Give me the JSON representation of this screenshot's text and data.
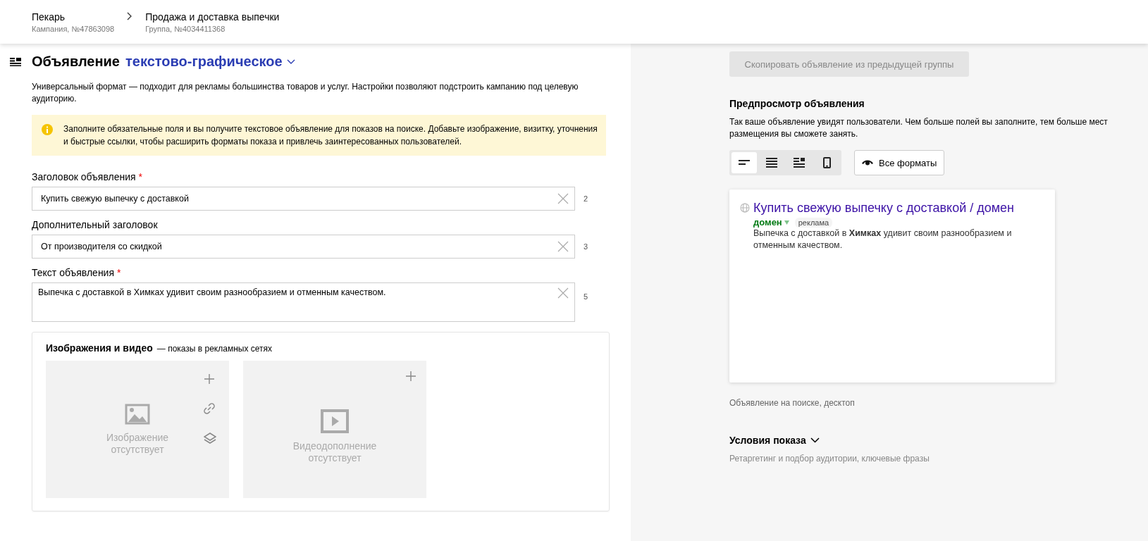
{
  "header": {
    "breadcrumbs": [
      {
        "title": "Пекарь",
        "subtitle": "Кампания, №47863098"
      },
      {
        "title": "Продажа и доставка выпечки",
        "subtitle": "Группа, №4034411368"
      }
    ]
  },
  "ad_type": {
    "prefix": "Объявление",
    "value": "текстово-графическое"
  },
  "description": "Универсальный формат — подходит для рекламы большинства товаров и услуг. Настройки позволяют подстроить кампанию под целевую аудиторию.",
  "notice": "Заполните обязательные поля и вы получите текстовое объявление для показов на поиске. Добавьте изображение, визитку, уточнения и быстрые ссылки, чтобы расширить форматы показа и привлечь заинтересованных пользователей.",
  "required_mark": "*",
  "fields": [
    {
      "kind": "input",
      "label": "Заголовок объявления",
      "required": true,
      "value": "Купить свежую выпечку с доставкой",
      "counter": "2"
    },
    {
      "kind": "input",
      "label": "Дополнительный заголовок",
      "required": false,
      "value": "От производителя со скидкой",
      "counter": "3"
    },
    {
      "kind": "textarea",
      "label": "Текст объявления",
      "required": true,
      "value": "Выпечка с доставкой в Химках удивит своим разнообразием и отменным качеством.",
      "counter": "5"
    }
  ],
  "media": {
    "title": "Изображения и видео",
    "subtitle": "— показы в рекламных сетях",
    "slots": [
      {
        "kind": "image",
        "text": "Изображение отсутствует"
      },
      {
        "kind": "video",
        "text": "Видеодополнение отсутствует"
      }
    ]
  },
  "preview": {
    "copy_button": "Скопировать объявление из предыдущей группы",
    "title": "Предпросмотр объявления",
    "description": "Так ваше объявление увидят пользователи. Чем больше полей вы заполните, тем больше мест размещения вы сможете занять.",
    "formats": [
      {
        "kind": "search",
        "selected": true
      },
      {
        "kind": "lines",
        "selected": false
      },
      {
        "kind": "image",
        "selected": false
      },
      {
        "kind": "mobile",
        "selected": false
      }
    ],
    "all_formats_button": "Все форматы",
    "ad": {
      "title": "Купить свежую выпечку с доставкой / домен",
      "domain": "домен",
      "badge": "реклама",
      "text": "Выпечка с доставкой в **Химках** удивит своим разнообразием и отменным качеством."
    },
    "caption": "Объявление на поиске, десктоп"
  },
  "conditions": {
    "title": "Условия показа",
    "subtitle": "Ретаргетинг и подбор аудитории, ключевые фразы"
  }
}
